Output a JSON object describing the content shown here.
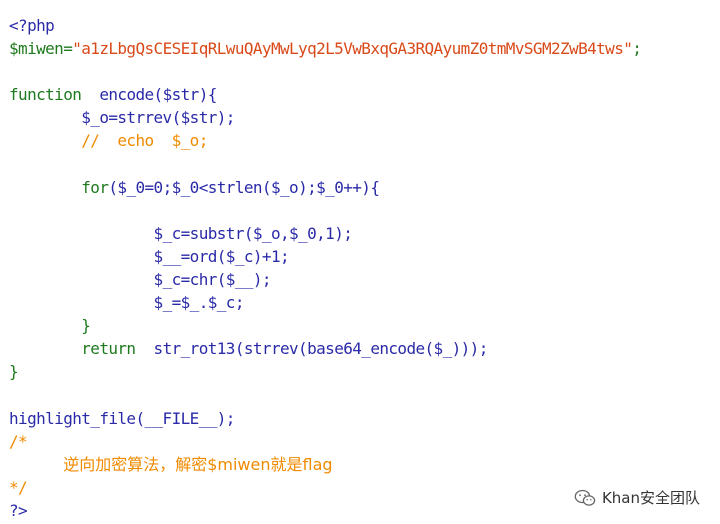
{
  "code_lines": [
    [
      {
        "t": "<?php",
        "c": "default"
      }
    ],
    [
      {
        "t": "$miwen=",
        "c": "green"
      },
      {
        "t": "\"a1zLbgQsCESEIqRLwuQAyMwLyq2L5VwBxqGA3RQAyumZ0tmMvSGM2ZwB4tws\"",
        "c": "string"
      },
      {
        "t": ";",
        "c": "green"
      }
    ],
    [],
    [
      {
        "t": "function  ",
        "c": "green"
      },
      {
        "t": "encode($str){",
        "c": "default"
      }
    ],
    [
      {
        "t": "        ",
        "c": "default"
      },
      {
        "t": "$_o=strrev($str);",
        "c": "default"
      }
    ],
    [
      {
        "t": "        ",
        "c": "default"
      },
      {
        "t": "//  echo  $_o;",
        "c": "comment"
      }
    ],
    [],
    [
      {
        "t": "        ",
        "c": "default"
      },
      {
        "t": "for",
        "c": "green"
      },
      {
        "t": "($_0=0;$_0<strlen($_o);$_0++){",
        "c": "default"
      }
    ],
    [],
    [
      {
        "t": "                ",
        "c": "default"
      },
      {
        "t": "$_c=substr($_o,$_0,1);",
        "c": "default"
      }
    ],
    [
      {
        "t": "                ",
        "c": "default"
      },
      {
        "t": "$__=ord($_c)+1;",
        "c": "default"
      }
    ],
    [
      {
        "t": "                ",
        "c": "default"
      },
      {
        "t": "$_c=chr($__);",
        "c": "default"
      }
    ],
    [
      {
        "t": "                ",
        "c": "default"
      },
      {
        "t": "$_=$_.$_c;",
        "c": "default"
      }
    ],
    [
      {
        "t": "        ",
        "c": "default"
      },
      {
        "t": "}",
        "c": "green"
      }
    ],
    [
      {
        "t": "        ",
        "c": "default"
      },
      {
        "t": "return  ",
        "c": "green"
      },
      {
        "t": "str_rot13(strrev(base64_encode($_)));",
        "c": "default"
      }
    ],
    [
      {
        "t": "}",
        "c": "green"
      }
    ],
    [],
    [
      {
        "t": "highlight_file(__FILE__);",
        "c": "default"
      }
    ],
    [
      {
        "t": "/*",
        "c": "comment"
      }
    ],
    [
      {
        "t": "      ",
        "c": "comment"
      },
      {
        "t": "逆向加密算法，解密$miwen就是flag",
        "c": "cjk"
      }
    ],
    [
      {
        "t": "*/",
        "c": "comment"
      }
    ],
    [
      {
        "t": "?>",
        "c": "default"
      }
    ]
  ],
  "watermark": {
    "text": "Khan安全团队",
    "icon": "wechat-icon"
  }
}
